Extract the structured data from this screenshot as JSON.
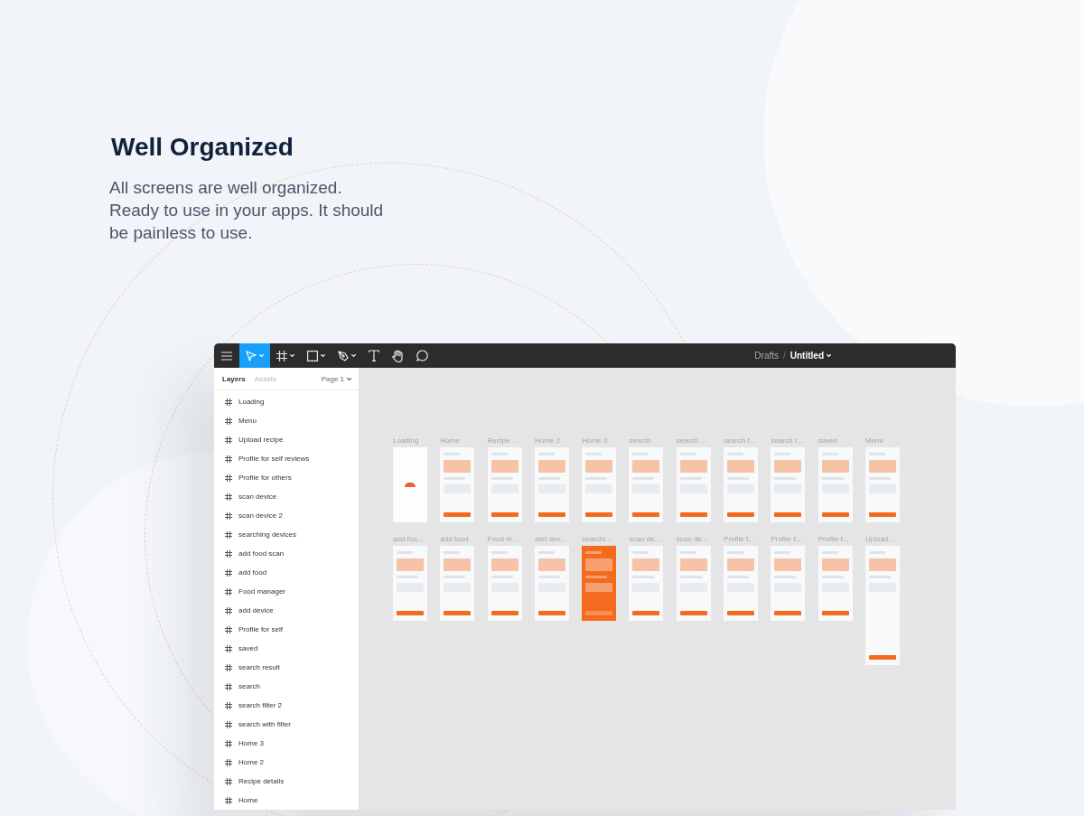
{
  "heading": "Well Organized",
  "description": "All screens are well organized.\nReady to use in your apps. It should\nbe painless to use.",
  "editor": {
    "toolbar": {
      "tools": [
        {
          "kind": "menu",
          "selected": false
        },
        {
          "kind": "move",
          "selected": true
        },
        {
          "kind": "frame",
          "selected": false
        },
        {
          "kind": "rectangle",
          "selected": false
        },
        {
          "kind": "pen",
          "selected": false
        },
        {
          "kind": "text",
          "selected": false
        },
        {
          "kind": "hand",
          "selected": false
        },
        {
          "kind": "comment",
          "selected": false
        }
      ],
      "breadcrumb": {
        "folder": "Drafts",
        "separator": "/",
        "file": "Untitled"
      }
    },
    "panel": {
      "tabs": [
        {
          "label": "Layers",
          "selected": true
        },
        {
          "label": "Assets",
          "selected": false
        }
      ],
      "page": "Page 1",
      "layers": [
        "Loading",
        "Menu",
        "Upload recipe",
        "Profile for self reviews",
        "Profile for others",
        "scan device",
        "scan device 2",
        "searching devices",
        "add food scan",
        "add food",
        "Food manager",
        "add device",
        "Profile for self",
        "saved",
        "search result",
        "search",
        "search filter 2",
        "search with filter",
        "Home 3",
        "Home 2",
        "Recipe details",
        "Home"
      ]
    },
    "canvas": {
      "rows": [
        [
          {
            "label": "Loading",
            "kind": "plain"
          },
          {
            "label": "Home",
            "kind": "light"
          },
          {
            "label": "Recipe ...",
            "kind": "light"
          },
          {
            "label": "Home 2",
            "kind": "light"
          },
          {
            "label": "Home 3",
            "kind": "light"
          },
          {
            "label": "search",
            "kind": "light"
          },
          {
            "label": "search ...",
            "kind": "light"
          },
          {
            "label": "search f...",
            "kind": "light"
          },
          {
            "label": "search r...",
            "kind": "light"
          },
          {
            "label": "saved",
            "kind": "light"
          },
          {
            "label": "Menu",
            "kind": "light"
          }
        ],
        [
          {
            "label": "add foo...",
            "kind": "light"
          },
          {
            "label": "add food",
            "kind": "light"
          },
          {
            "label": "Food m...",
            "kind": "light"
          },
          {
            "label": "add dev...",
            "kind": "light"
          },
          {
            "label": "searchi...",
            "kind": "orange"
          },
          {
            "label": "scan de...",
            "kind": "light"
          },
          {
            "label": "scan de...",
            "kind": "light"
          },
          {
            "label": "Profile f...",
            "kind": "light"
          },
          {
            "label": "Profile f...",
            "kind": "light"
          },
          {
            "label": "Profile f...",
            "kind": "light"
          },
          {
            "label": "Upload ...",
            "kind": "long"
          }
        ]
      ]
    }
  }
}
